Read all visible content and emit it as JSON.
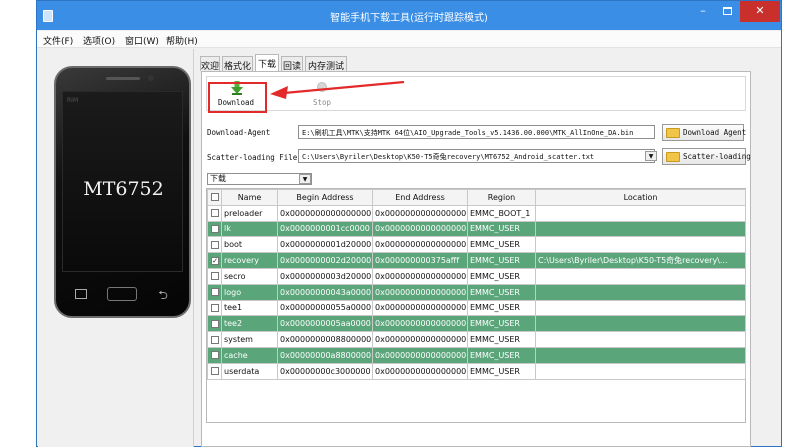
{
  "window": {
    "title": "智能手机下载工具(运行时跟踪模式)",
    "minimize": "–",
    "close": "✕"
  },
  "menu": [
    "文件(F)",
    "选项(O)",
    "窗口(W)",
    "帮助(H)"
  ],
  "phone": {
    "rim_text": "RIM",
    "model": "MT6752"
  },
  "tabs": [
    "欢迎",
    "格式化",
    "下载",
    "回读",
    "内存测试"
  ],
  "active_tab": "下载",
  "toolbar": {
    "download_label": "Download",
    "stop_label": "Stop"
  },
  "download_agent": {
    "label": "Download-Agent",
    "value": "E:\\刷机工具\\MTK\\支持MTK 64位\\AIO_Upgrade_Tools_v5.1436.00.000\\MTK_AllInOne_DA.bin",
    "button": "Download Agent"
  },
  "scatter": {
    "label": "Scatter-loading File",
    "value": "C:\\Users\\Byriler\\Desktop\\K50-T5奇兔recovery\\MT6752_Android_scatter.txt",
    "button": "Scatter-loading"
  },
  "mode_select": "下载",
  "table": {
    "headers": [
      "",
      "Name",
      "Begin Address",
      "End Address",
      "Region",
      "Location"
    ],
    "rows": [
      {
        "checked": false,
        "selected": false,
        "name": "preloader",
        "begin": "0x0000000000000000",
        "end": "0x0000000000000000",
        "region": "EMMC_BOOT_1",
        "location": ""
      },
      {
        "checked": false,
        "selected": true,
        "name": "lk",
        "begin": "0x0000000001cc0000",
        "end": "0x0000000000000000",
        "region": "EMMC_USER",
        "location": ""
      },
      {
        "checked": false,
        "selected": false,
        "name": "boot",
        "begin": "0x0000000001d20000",
        "end": "0x0000000000000000",
        "region": "EMMC_USER",
        "location": ""
      },
      {
        "checked": true,
        "selected": true,
        "name": "recovery",
        "begin": "0x0000000002d20000",
        "end": "0x000000000375afff",
        "region": "EMMC_USER",
        "location": "C:\\Users\\Byriler\\Desktop\\K50-T5奇兔recovery\\..."
      },
      {
        "checked": false,
        "selected": false,
        "name": "secro",
        "begin": "0x0000000003d20000",
        "end": "0x0000000000000000",
        "region": "EMMC_USER",
        "location": ""
      },
      {
        "checked": false,
        "selected": true,
        "name": "logo",
        "begin": "0x00000000043a0000",
        "end": "0x0000000000000000",
        "region": "EMMC_USER",
        "location": ""
      },
      {
        "checked": false,
        "selected": false,
        "name": "tee1",
        "begin": "0x00000000055a0000",
        "end": "0x0000000000000000",
        "region": "EMMC_USER",
        "location": ""
      },
      {
        "checked": false,
        "selected": true,
        "name": "tee2",
        "begin": "0x0000000005aa0000",
        "end": "0x0000000000000000",
        "region": "EMMC_USER",
        "location": ""
      },
      {
        "checked": false,
        "selected": false,
        "name": "system",
        "begin": "0x0000000008800000",
        "end": "0x0000000000000000",
        "region": "EMMC_USER",
        "location": ""
      },
      {
        "checked": false,
        "selected": true,
        "name": "cache",
        "begin": "0x00000000a8800000",
        "end": "0x0000000000000000",
        "region": "EMMC_USER",
        "location": ""
      },
      {
        "checked": false,
        "selected": false,
        "name": "userdata",
        "begin": "0x00000000c3000000",
        "end": "0x0000000000000000",
        "region": "EMMC_USER",
        "location": ""
      }
    ]
  },
  "colors": {
    "titlebar": "#3a8ee6",
    "selected_row": "#5aa57a",
    "highlight": "#e22a2a"
  }
}
